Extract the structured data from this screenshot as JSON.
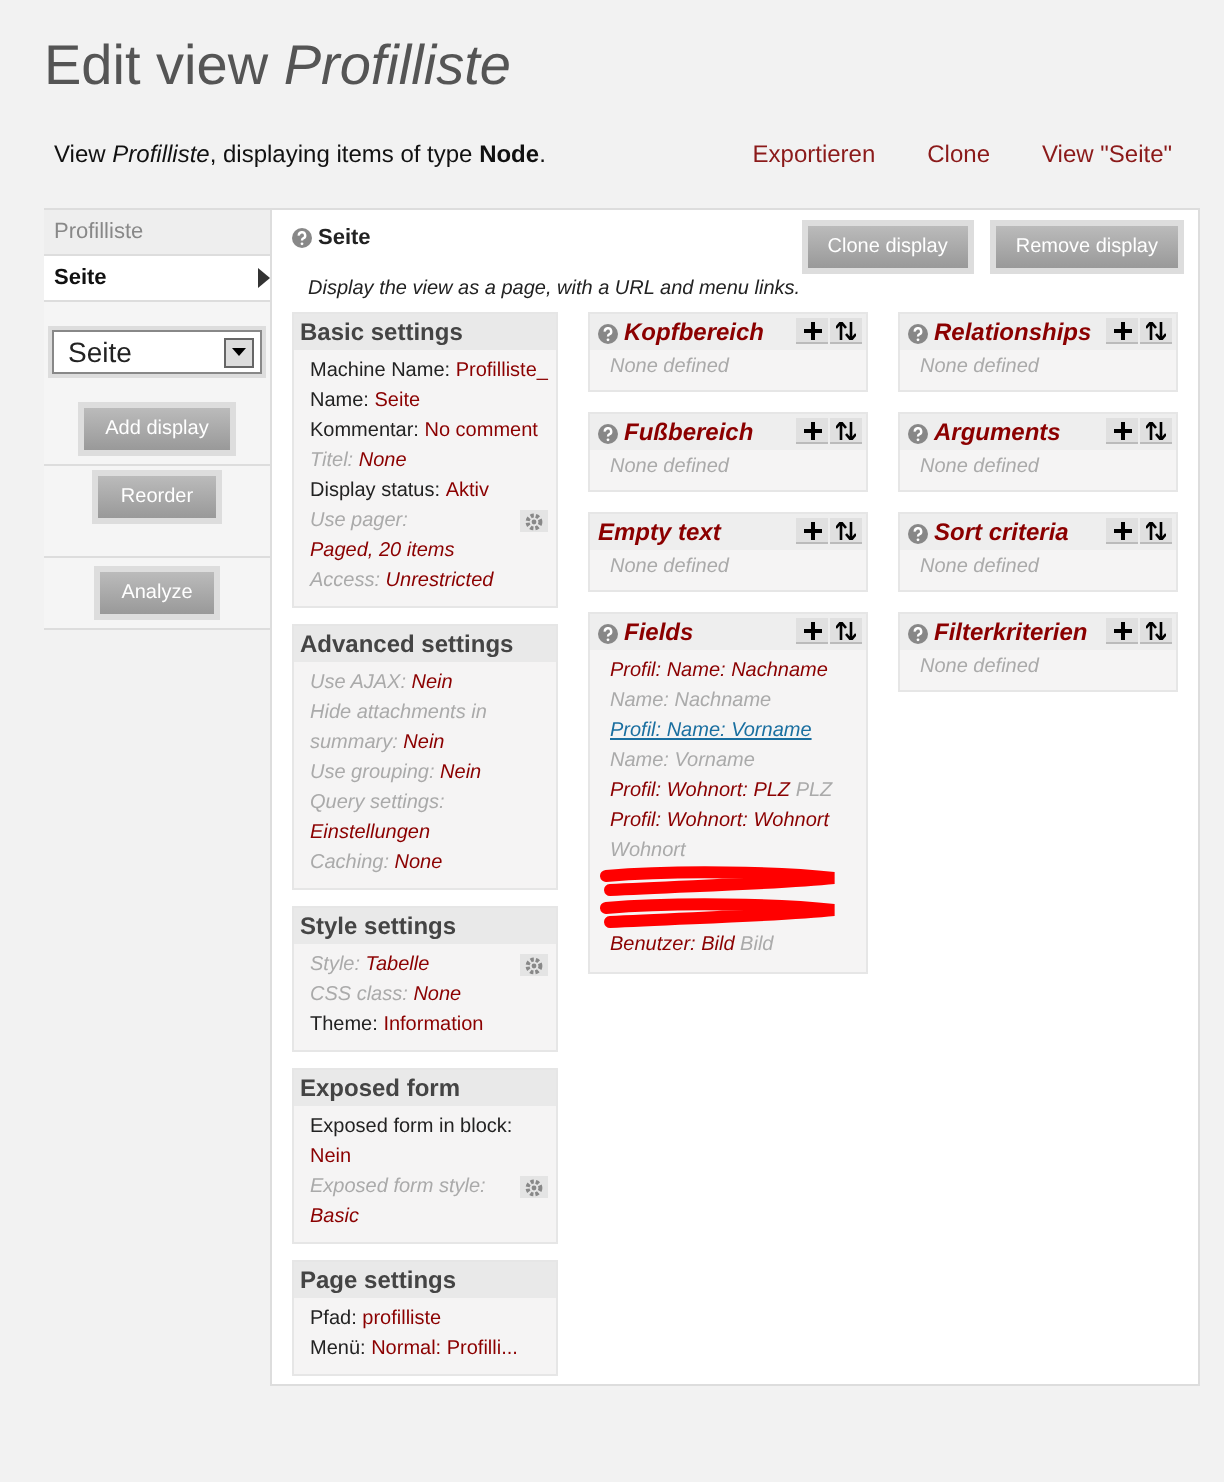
{
  "title": {
    "prefix": "Edit view",
    "name": "Profilliste"
  },
  "description": "View *Profilliste*, displaying items of type **Node**.",
  "links": [
    "Exportieren",
    "Clone",
    "View \"Seite\""
  ],
  "sidebar": {
    "tabs": [
      {
        "label": "Profilliste",
        "selected": false
      },
      {
        "label": "Seite",
        "selected": true
      }
    ],
    "select": {
      "value": "Seite"
    },
    "buttons": [
      "Add display",
      "Reorder",
      "Analyze"
    ]
  },
  "display": {
    "title": "Seite",
    "buttons": [
      "Clone display",
      "Remove display"
    ],
    "description": "Display the view as a page, with a URL and menu links."
  },
  "settings": [
    {
      "title": "Basic settings",
      "items": [
        {
          "label": "Machine Name:",
          "value": "Profilliste_",
          "inherited": false,
          "gear": false
        },
        {
          "label": "Name:",
          "value": "Seite",
          "inherited": false,
          "gear": false
        },
        {
          "label": "Kommentar:",
          "value": "No comment",
          "inherited": false,
          "gear": false
        },
        {
          "label": "Titel:",
          "value": "None",
          "inherited": true,
          "gear": false
        },
        {
          "label": "Display status:",
          "value": "Aktiv",
          "inherited": false,
          "gear": false
        },
        {
          "label": "Use pager:",
          "value": "Paged, 20 items",
          "inherited": true,
          "gear": true
        },
        {
          "label": "Access:",
          "value": "Unrestricted",
          "inherited": true,
          "gear": false
        }
      ]
    },
    {
      "title": "Advanced settings",
      "items": [
        {
          "label": "Use AJAX:",
          "value": "Nein",
          "inherited": true,
          "gear": false
        },
        {
          "label": "Hide attachments in summary:",
          "value": "Nein",
          "inherited": true,
          "gear": false
        },
        {
          "label": "Use grouping:",
          "value": "Nein",
          "inherited": true,
          "gear": false
        },
        {
          "label": "Query settings:",
          "value": "Einstellungen",
          "inherited": true,
          "gear": false
        },
        {
          "label": "Caching:",
          "value": "None",
          "inherited": true,
          "gear": false
        }
      ]
    },
    {
      "title": "Style settings",
      "items": [
        {
          "label": "Style:",
          "value": "Tabelle",
          "inherited": true,
          "gear": true
        },
        {
          "label": "CSS class:",
          "value": "None",
          "inherited": true,
          "gear": false
        },
        {
          "label": "Theme:",
          "value": "Information",
          "inherited": false,
          "gear": false
        }
      ]
    },
    {
      "title": "Exposed form",
      "items": [
        {
          "label": "Exposed form in block:",
          "value": "Nein",
          "inherited": false,
          "gear": false
        },
        {
          "label": "Exposed form style:",
          "value": "Basic",
          "inherited": true,
          "gear": true
        }
      ]
    },
    {
      "title": "Page settings",
      "items": [
        {
          "label": "Pfad:",
          "value": "profilliste",
          "inherited": false,
          "gear": false
        },
        {
          "label": "Menü:",
          "value": "Normal: Profilli...",
          "inherited": false,
          "gear": false
        }
      ]
    }
  ],
  "columns": [
    [
      {
        "title": "Kopfbereich",
        "help": true,
        "empty": "None defined"
      },
      {
        "title": "Fußbereich",
        "help": true,
        "empty": "None defined"
      },
      {
        "title": "Empty text",
        "help": false,
        "empty": "None defined"
      },
      {
        "title": "Fields",
        "help": true,
        "fields": [
          {
            "kind": "field",
            "name": "Profil: Name: Nachname",
            "label": "Name: Nachname"
          },
          {
            "kind": "link",
            "name": "Profil: Name: Vorname",
            "label": "Name: Vorname"
          },
          {
            "kind": "field",
            "name": "Profil: Wohnort: PLZ",
            "label": "PLZ"
          },
          {
            "kind": "field",
            "name": "Profil: Wohnort: Wohnort",
            "label": "Wohnort"
          },
          {
            "kind": "redacted"
          },
          {
            "kind": "redacted"
          },
          {
            "kind": "field",
            "name": "Benutzer: Bild",
            "label": "Bild"
          }
        ]
      }
    ],
    [
      {
        "title": "Relationships",
        "help": true,
        "empty": "None defined"
      },
      {
        "title": "Arguments",
        "help": true,
        "empty": "None defined"
      },
      {
        "title": "Sort criteria",
        "help": true,
        "empty": "None defined"
      },
      {
        "title": "Filterkriterien",
        "help": true,
        "empty": "None defined"
      }
    ]
  ]
}
